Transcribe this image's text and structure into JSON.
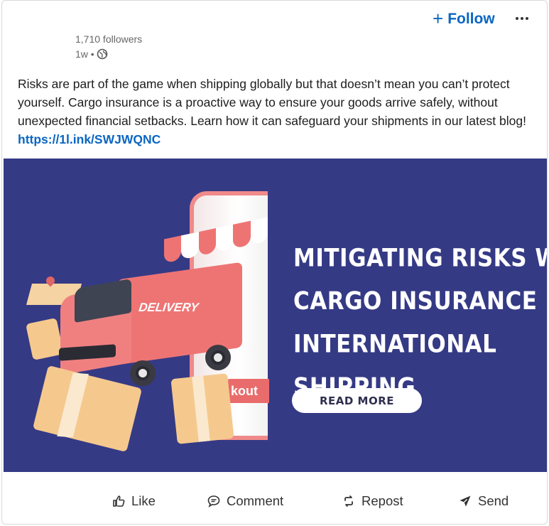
{
  "header": {
    "follow_label": "Follow",
    "followers": "1,710 followers",
    "timestamp": "1w •"
  },
  "post": {
    "text": "Risks are part of the game when shipping globally but that doesn’t mean you can’t protect yourself. Cargo insurance is a proactive way to ensure your goods arrive safely, without unexpected financial setbacks. Learn how it can safeguard your shipments in our latest blog! ",
    "link": "https://1l.ink/SWJWQNC"
  },
  "banner": {
    "title_lines": [
      "MITIGATING RISKS WITH",
      "CARGO INSURANCE IN",
      "INTERNATIONAL",
      "SHIPPING"
    ],
    "button_label": "READ MORE",
    "truck_label": "DELIVERY",
    "phone_label": "kout",
    "background_color": "#353a85"
  },
  "actions": {
    "like": "Like",
    "comment": "Comment",
    "repost": "Repost",
    "send": "Send"
  },
  "colors": {
    "link": "#0a66c2",
    "accent_red": "#ee7474"
  },
  "icons": {
    "follow": "plus-icon",
    "more": "more-options-icon",
    "visibility": "globe-icon",
    "like": "thumbs-up-icon",
    "comment": "comment-icon",
    "repost": "repost-icon",
    "send": "send-icon"
  }
}
